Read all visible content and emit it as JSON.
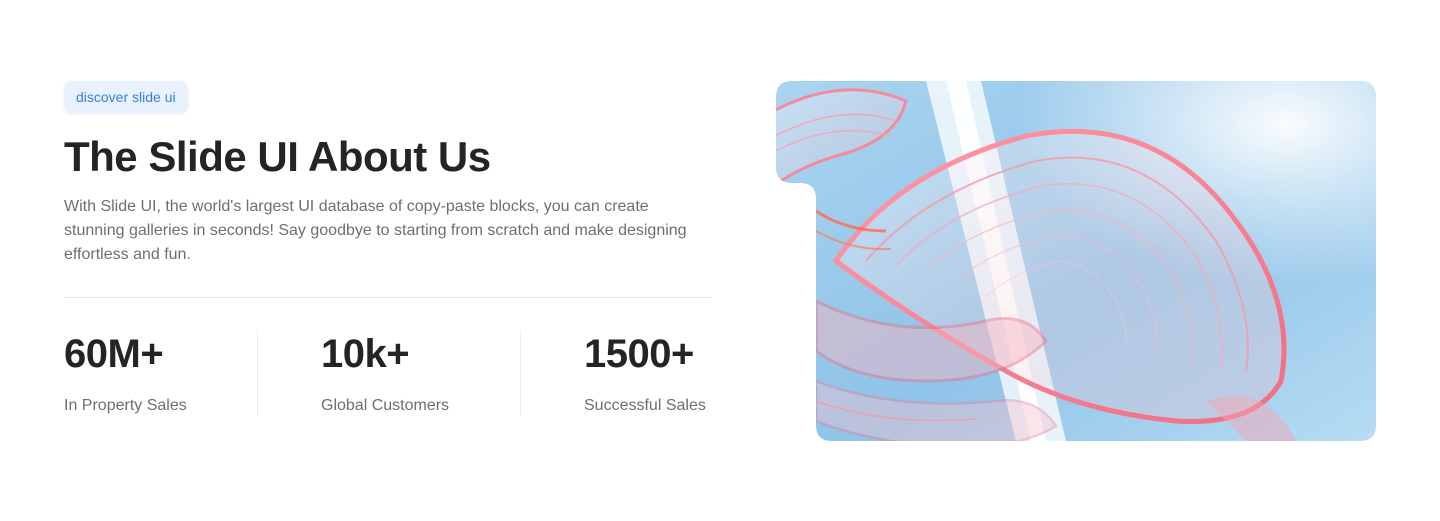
{
  "badge": "discover slide ui",
  "title": "The Slide UI About Us",
  "description": "With Slide UI, the world's largest UI database of copy-paste blocks, you can create stunning galleries in seconds! Say goodbye to starting from scratch and make designing effortless and fun.",
  "stats": [
    {
      "value": "60M+",
      "label": "In Property Sales"
    },
    {
      "value": "10k+",
      "label": "Global Customers"
    },
    {
      "value": "1500+",
      "label": "Successful Sales"
    }
  ],
  "colors": {
    "accent": "#3b82d6",
    "heading": "#222528",
    "body": "#6b6f75",
    "sky": "#8ec5ea",
    "glass_pink": "#f48a9a"
  },
  "image": {
    "icon": "abstract-glass-image"
  }
}
